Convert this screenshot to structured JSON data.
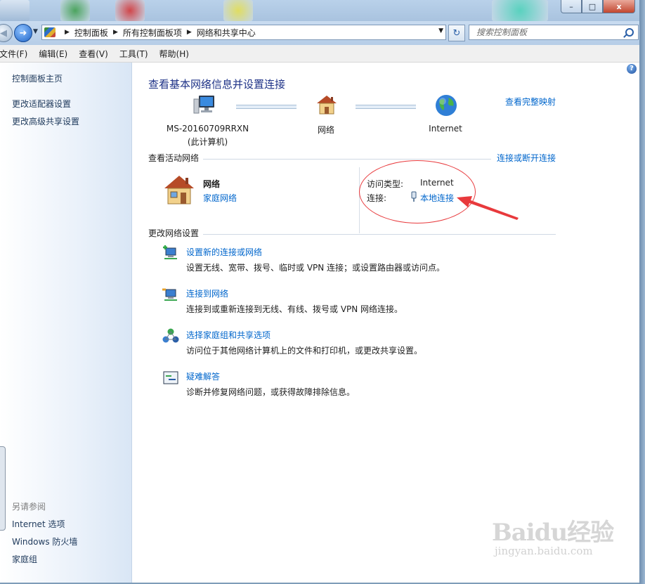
{
  "window": {
    "controls": {
      "minimize": "–",
      "maximize": "□",
      "close": "x"
    }
  },
  "address": {
    "breadcrumb": [
      "控制面板",
      "所有控制面板项",
      "网络和共享中心"
    ],
    "search_placeholder": "搜索控制面板"
  },
  "menu": [
    "文件(F)",
    "编辑(E)",
    "查看(V)",
    "工具(T)",
    "帮助(H)"
  ],
  "sidebar": {
    "links": [
      "控制面板主页",
      "更改适配器设置",
      "更改高级共享设置"
    ],
    "see_also_title": "另请参阅",
    "see_also": [
      "Internet 选项",
      "Windows 防火墙",
      "家庭组"
    ]
  },
  "main": {
    "help": "?",
    "title": "查看基本网络信息并设置连接",
    "full_map_link": "查看完整映射",
    "map": {
      "computer_name": "MS-20160709RRXN",
      "computer_sub": "(此计算机)",
      "network": "网络",
      "internet": "Internet"
    },
    "active_header": "查看活动网络",
    "connect_link": "连接或断开连接",
    "active": {
      "name": "网络",
      "category": "家庭网络",
      "access_label": "访问类型:",
      "access_value": "Internet",
      "connection_label": "连接:",
      "connection_value": "本地连接"
    },
    "change_header": "更改网络设置",
    "tasks": [
      {
        "title": "设置新的连接或网络",
        "desc": "设置无线、宽带、拨号、临时或 VPN 连接；或设置路由器或访问点。"
      },
      {
        "title": "连接到网络",
        "desc": "连接到或重新连接到无线、有线、拨号或 VPN 网络连接。"
      },
      {
        "title": "选择家庭组和共享选项",
        "desc": "访问位于其他网络计算机上的文件和打印机，或更改共享设置。"
      },
      {
        "title": "疑难解答",
        "desc": "诊断并修复网络问题，或获得故障排除信息。"
      }
    ]
  },
  "watermark": {
    "logo": "Baidu经验",
    "sub": "jingyan.baidu.com"
  },
  "colors": {
    "link": "#0066cc",
    "title": "#1e3287",
    "annotation": "#e8393c"
  }
}
